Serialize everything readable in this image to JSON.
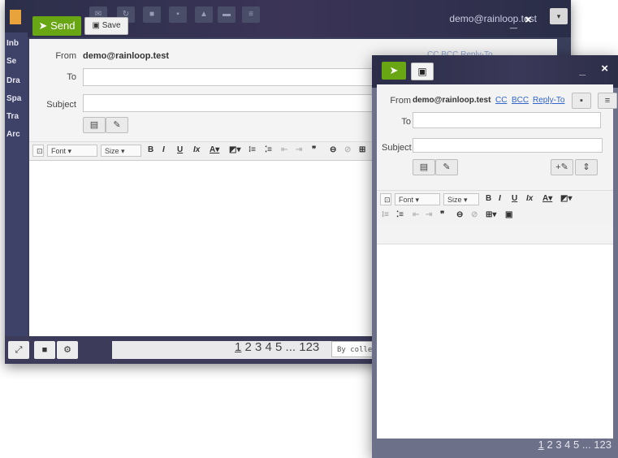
{
  "bg_window": {
    "user_email": "demo@rainloop.test",
    "folders": [
      "Inb",
      "Se",
      "Dra",
      "Spa",
      "Tra",
      "Arc"
    ],
    "compose": {
      "send_label": "Send",
      "save_label": "Save",
      "from_label": "From",
      "from_value": "demo@rainloop.test",
      "to_label": "To",
      "subject_label": "Subject",
      "cc_links": "CC  BCC  Reply-To",
      "toolbar": {
        "font": "Font",
        "size": "Size"
      }
    },
    "pager": {
      "first": "1",
      "rest": " 2 3 4 5 ... 123"
    },
    "sort_label": "By collecti"
  },
  "sm_window": {
    "from_label": "From",
    "from_value": "demo@rainloop.test",
    "cc": "CC",
    "bcc": "BCC",
    "reply_to": "Reply-To",
    "to_label": "To",
    "subject_label": "Subject",
    "toolbar": {
      "font": "Font",
      "size": "Size"
    },
    "pager": {
      "first": "1",
      "rest": " 2 3 4 5 ... 123"
    }
  }
}
